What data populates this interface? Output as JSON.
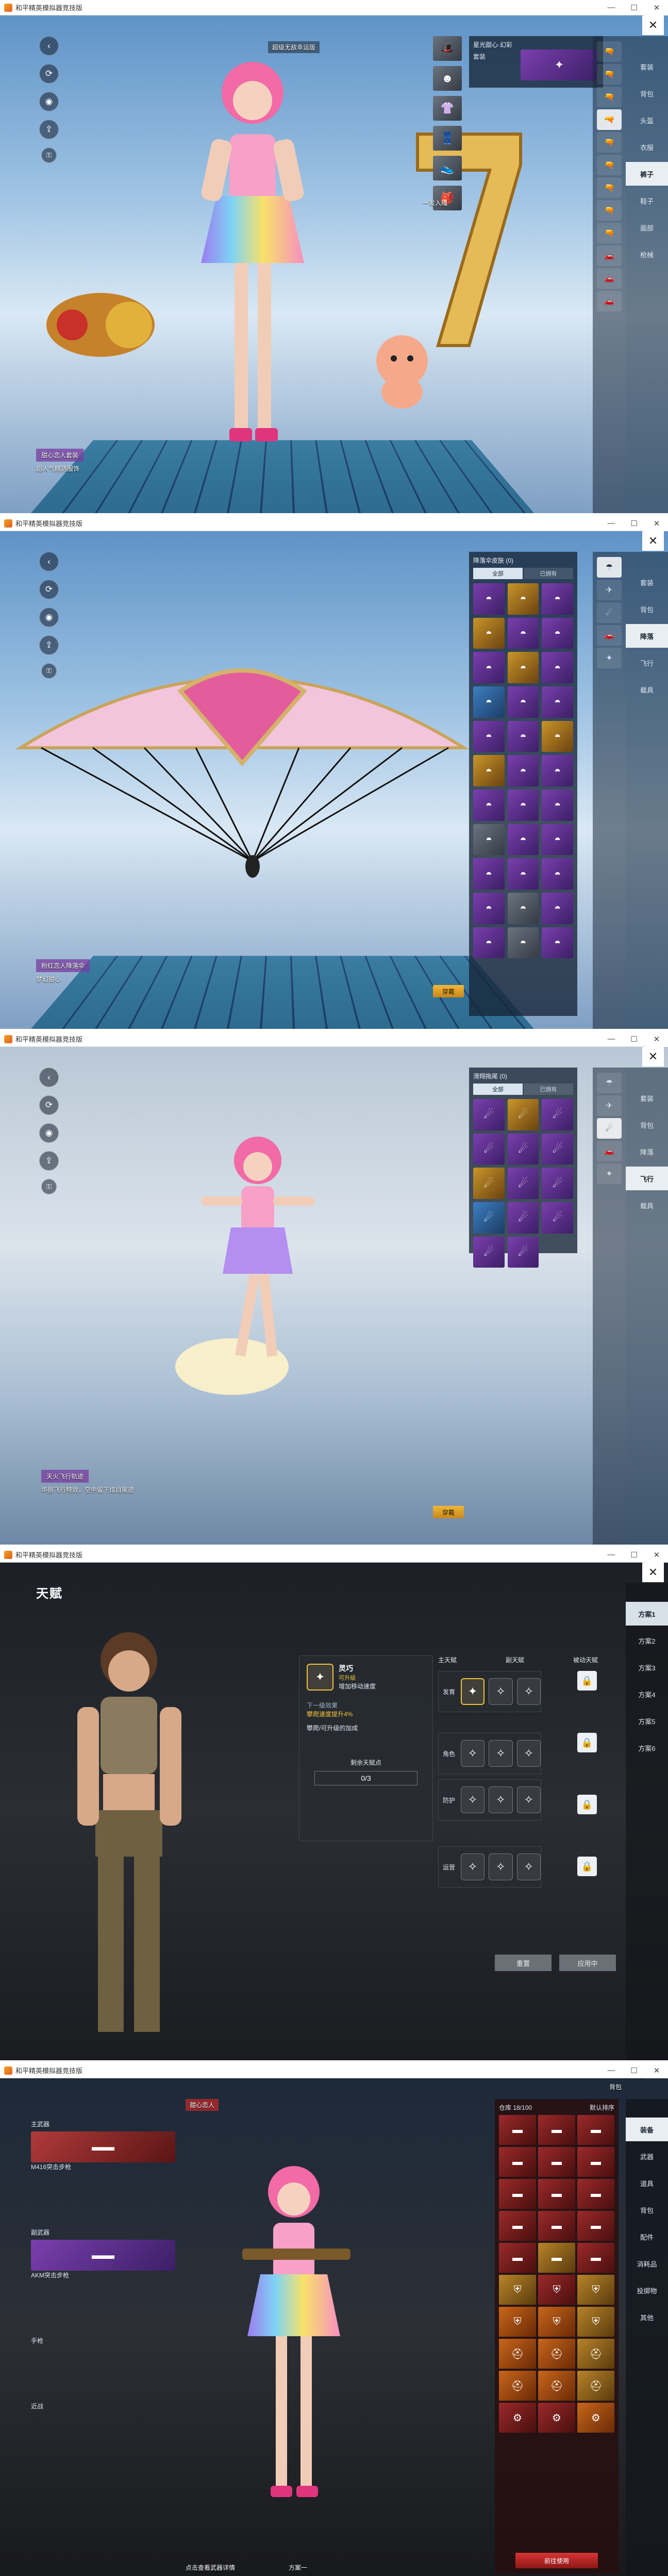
{
  "window": {
    "title": "和平精英模拟器竞技版",
    "minimize": "—",
    "maximize": "☐",
    "close": "✕"
  },
  "screens": {
    "s1": {
      "top_label": "超级无敌幸运版",
      "item_name": "星光甜心·幻彩",
      "item_sub": "套装",
      "character_tag": "甜心恋人套装",
      "character_desc": "超人气精选服饰",
      "small_hint": "一发入魂",
      "right_nav": [
        "套装",
        "背包",
        "头盔",
        "衣服",
        "裤子",
        "鞋子",
        "面部",
        "枪械"
      ],
      "right_nav_active": 4,
      "weapon_rows": 8
    },
    "s2": {
      "panel_title": "降落伞皮肤 (0) ",
      "tabs": [
        "全部",
        "已拥有"
      ],
      "tab_active": 0,
      "character_tag": "粉红恋人降落伞",
      "character_desc": "梦幻甜心",
      "confirm_label": "穿戴",
      "right_nav": [
        "套装",
        "背包",
        "降落",
        "飞行",
        "载具"
      ],
      "right_nav_active": 2,
      "grid_count": 33
    },
    "s3": {
      "panel_title": "滑翔拖尾 (0) ",
      "tabs": [
        "全部",
        "已拥有"
      ],
      "tab_active": 0,
      "character_tag": "天火飞行轨迹",
      "character_desc": "华丽飞行特效，空中留下炫目尾迹",
      "confirm_label": "穿戴",
      "right_nav": [
        "套装",
        "背包",
        "降落",
        "飞行",
        "载具"
      ],
      "right_nav_active": 3,
      "grid_count": 15
    },
    "s4": {
      "title": "天赋",
      "plans": [
        "方案1",
        "方案2",
        "方案3",
        "方案4",
        "方案5",
        "方案6"
      ],
      "plan_active": 0,
      "selected_talent": "灵巧",
      "selected_badge": "可升级",
      "selected_desc": "增加移动速度",
      "level_text": "下一级效果",
      "level_desc": "攀爬速度提升4%",
      "level_note": "攀爬/可升级的加成",
      "points_label": "剩余天赋点",
      "points_value": "0/3",
      "col_headers": [
        "主天赋",
        "副天赋",
        "被动天赋"
      ],
      "row_labels": [
        "发育",
        "角色",
        "防护",
        "运营"
      ],
      "reset_label": "重置",
      "apply_label": "应用中"
    },
    "s5": {
      "top_name": "甜心恋人",
      "slots_left": [
        "主武器",
        "副武器",
        "手枪",
        "近战"
      ],
      "weapon_name": "M416突击步枪",
      "weapon2_name": "AKM突击步枪",
      "plan_label": "方案一",
      "right_tabs": [
        "装备",
        "武器",
        "道具",
        "背包",
        "配件",
        "消耗品",
        "投掷物",
        "其他"
      ],
      "right_tab_active": 0,
      "count_text": "仓库 18/100",
      "filter": "默认排序",
      "confirm": "前往使用",
      "bottom_text": "点击查看武器详情",
      "top_right": "背包"
    }
  }
}
